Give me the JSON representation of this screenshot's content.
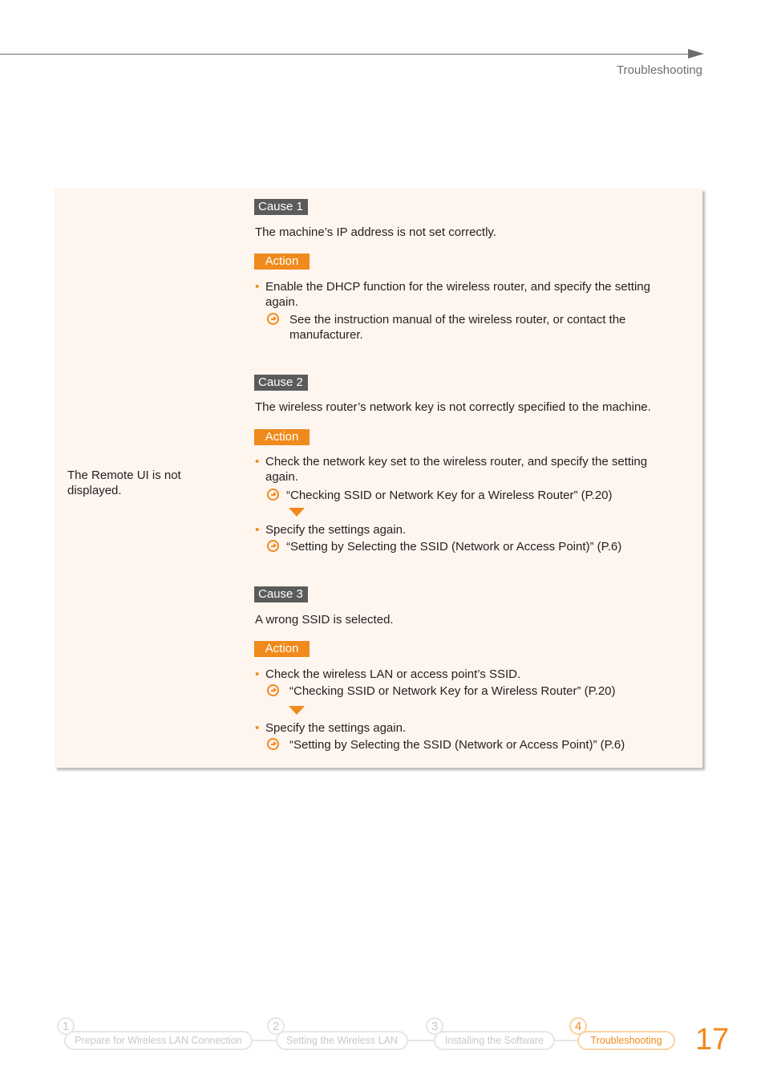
{
  "header": {
    "section": "Troubleshooting"
  },
  "symptom": "The Remote UI is not displayed.",
  "causes": [
    {
      "label": "Cause 1",
      "description": "The machine’s IP address is not set correctly.",
      "action_label": "Action",
      "steps": [
        {
          "text": "Enable the DHCP function for the wireless router, and specify the setting again.",
          "ref": "See the instruction manual of the wireless router, or contact the manufacturer."
        }
      ]
    },
    {
      "label": "Cause 2",
      "description": "The wireless router’s network key is not correctly specified to the machine.",
      "action_label": "Action",
      "steps": [
        {
          "text": "Check the network key set to the wireless router, and specify the setting again.",
          "ref": "“Checking SSID or Network Key for a Wireless Router” (P.20)"
        },
        {
          "text": "Specify the settings again.",
          "ref": "“Setting by Selecting the SSID (Network or Access Point)” (P.6)"
        }
      ]
    },
    {
      "label": "Cause 3",
      "description": "A wrong SSID is selected.",
      "action_label": "Action",
      "steps": [
        {
          "text": "Check the wireless LAN or access point’s SSID.",
          "ref": "“Checking SSID or Network Key for a Wireless Router” (P.20)"
        },
        {
          "text": "Specify the settings again.",
          "ref": "“Setting by Selecting the SSID (Network or Access Point)” (P.6)"
        }
      ]
    }
  ],
  "bullet_glyph": "•",
  "footer_nav": {
    "steps": [
      {
        "num": "1",
        "label": "Prepare for Wireless LAN Connection",
        "active": false
      },
      {
        "num": "2",
        "label": "Setting the Wireless LAN",
        "active": false
      },
      {
        "num": "3",
        "label": "Installing the Software",
        "active": false
      },
      {
        "num": "4",
        "label": "Troubleshooting",
        "active": true
      }
    ],
    "page_number": "17"
  },
  "colors": {
    "accent": "#f08a1c",
    "cause_badge": "#5b5b5b",
    "panel_bg": "#fef5ef",
    "inactive_nav": "#c8c8c8"
  }
}
